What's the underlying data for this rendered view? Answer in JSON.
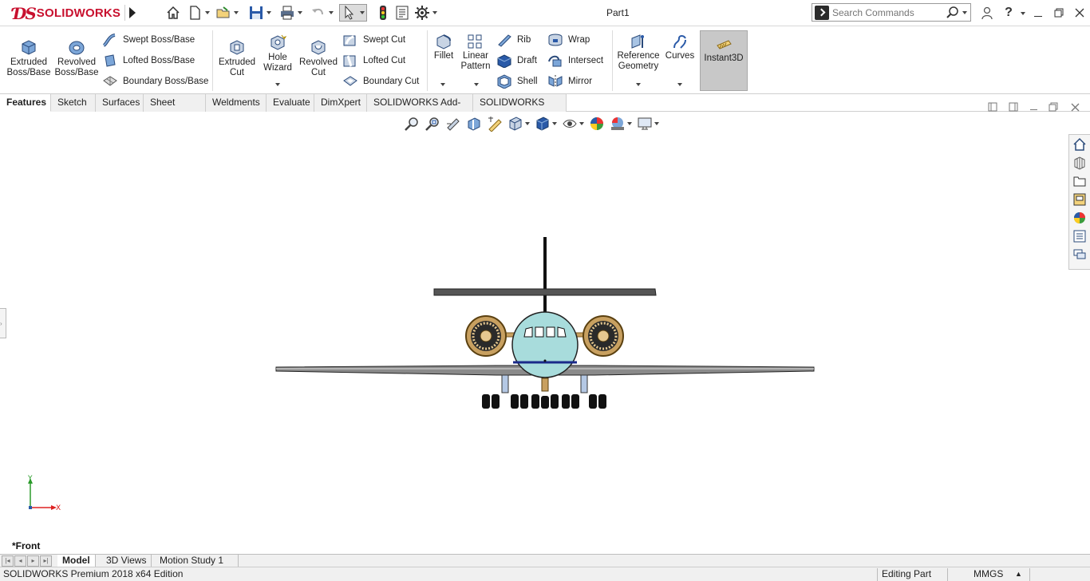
{
  "app": {
    "brand_prefix": "3DS",
    "brand": "SOLIDWORKS",
    "document_title": "Part1"
  },
  "search": {
    "placeholder": "Search Commands"
  },
  "help": {
    "label": "?"
  },
  "ribbon": {
    "extruded_boss": "Extruded Boss/Base",
    "revolved_boss": "Revolved Boss/Base",
    "swept_boss": "Swept Boss/Base",
    "lofted_boss": "Lofted Boss/Base",
    "boundary_boss": "Boundary Boss/Base",
    "extruded_cut": "Extruded Cut",
    "hole_wizard": "Hole Wizard",
    "revolved_cut": "Revolved Cut",
    "swept_cut": "Swept Cut",
    "lofted_cut": "Lofted Cut",
    "boundary_cut": "Boundary Cut",
    "fillet": "Fillet",
    "linear_pattern": "Linear Pattern",
    "rib": "Rib",
    "draft": "Draft",
    "shell": "Shell",
    "wrap": "Wrap",
    "intersect": "Intersect",
    "mirror": "Mirror",
    "reference_geometry": "Reference Geometry",
    "curves": "Curves",
    "instant3d": "Instant3D"
  },
  "tabs": [
    "Features",
    "Sketch",
    "Surfaces",
    "Sheet Metal",
    "Weldments",
    "Evaluate",
    "DimXpert",
    "SOLIDWORKS Add-Ins",
    "SOLIDWORKS MBD"
  ],
  "active_tab": "Features",
  "viewport": {
    "view_label": "*Front",
    "triad_x": "X",
    "triad_y": "Y"
  },
  "bottom_tabs": [
    "Model",
    "3D Views",
    "Motion Study 1"
  ],
  "status": {
    "edition": "SOLIDWORKS Premium 2018 x64 Edition",
    "mode": "Editing Part",
    "units": "MMGS"
  },
  "colors": {
    "brand": "#c8102e",
    "fuselage": "#a8dcdc",
    "engine": "#c8a060",
    "stripe": "#1a2a8a"
  }
}
